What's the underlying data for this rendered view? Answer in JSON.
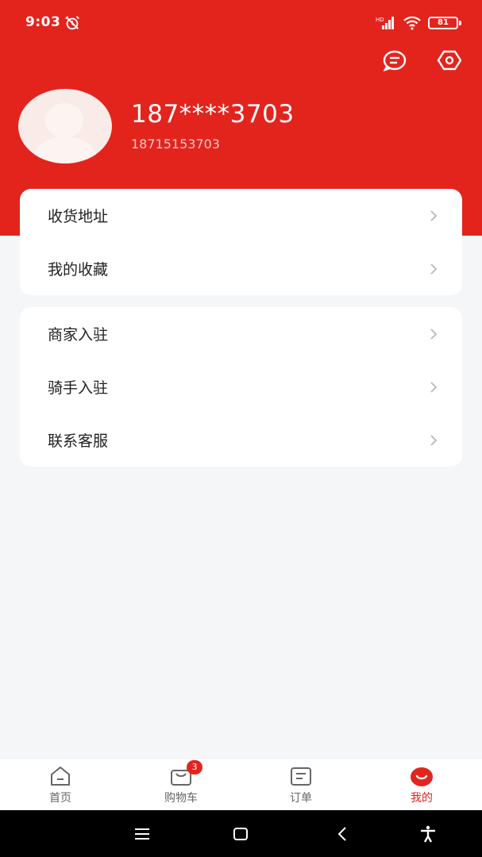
{
  "status_bar": {
    "time": "9:03",
    "battery": "81",
    "signal_label": "HD"
  },
  "header": {
    "icons": [
      "message-icon",
      "settings-hex-icon"
    ],
    "accent_color": "#e3241d"
  },
  "profile": {
    "masked_phone": "187****3703",
    "phone": "18715153703"
  },
  "menu_group_1": [
    {
      "label": "收货地址"
    },
    {
      "label": "我的收藏"
    }
  ],
  "menu_group_2": [
    {
      "label": "商家入驻"
    },
    {
      "label": "骑手入驻"
    },
    {
      "label": "联系客服"
    }
  ],
  "bottom_nav": {
    "items": [
      {
        "label": "首页",
        "icon": "home-icon"
      },
      {
        "label": "购物车",
        "icon": "cart-icon",
        "badge": "3"
      },
      {
        "label": "订单",
        "icon": "orders-icon"
      },
      {
        "label": "我的",
        "icon": "profile-icon",
        "active": true
      }
    ]
  },
  "system_nav": {
    "icons": [
      "menu-icon",
      "home-square-icon",
      "back-icon",
      "accessibility-icon"
    ]
  }
}
